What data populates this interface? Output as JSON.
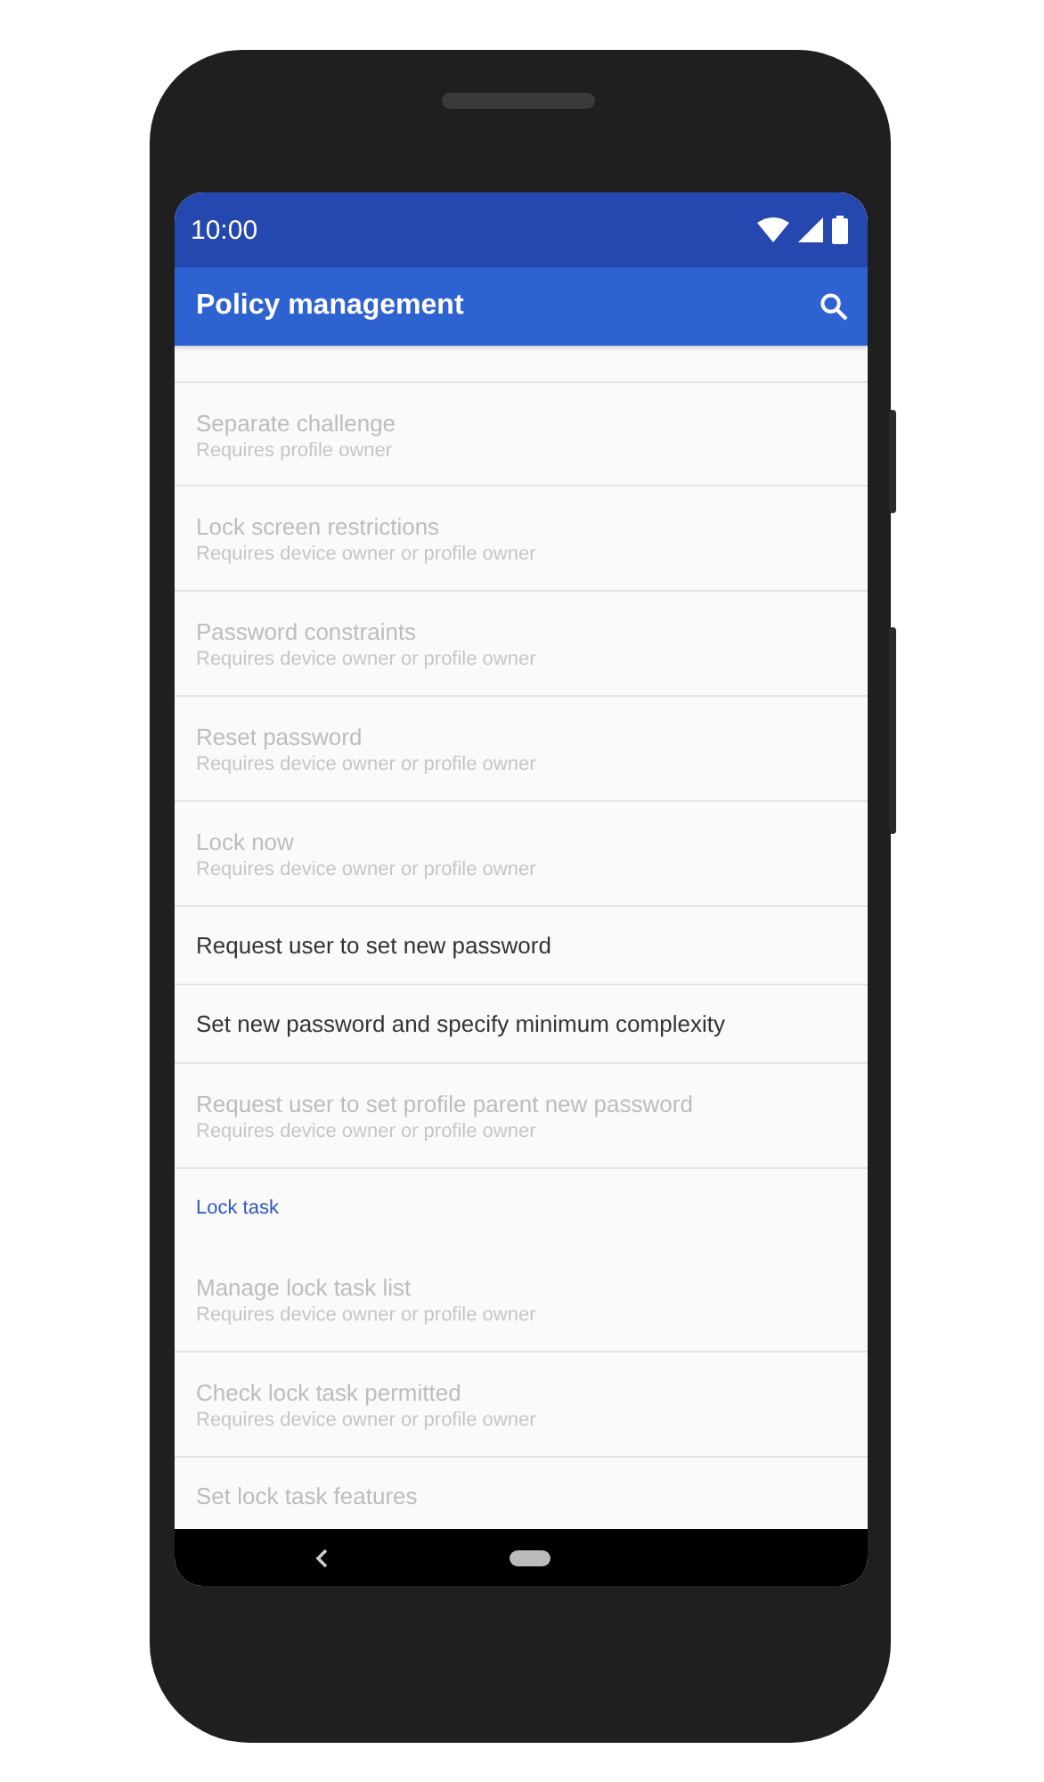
{
  "status_bar": {
    "time": "10:00"
  },
  "app_bar": {
    "title": "Policy management"
  },
  "list": [
    {
      "kind": "row",
      "title": "Separate challenge",
      "subtitle": "Requires profile owner",
      "disabled": true
    },
    {
      "kind": "row",
      "title": "Lock screen restrictions",
      "subtitle": "Requires device owner or profile owner",
      "disabled": true
    },
    {
      "kind": "row",
      "title": "Password constraints",
      "subtitle": "Requires device owner or profile owner",
      "disabled": true
    },
    {
      "kind": "row",
      "title": "Reset password",
      "subtitle": "Requires device owner or profile owner",
      "disabled": true
    },
    {
      "kind": "row",
      "title": "Lock now",
      "subtitle": "Requires device owner or profile owner",
      "disabled": true
    },
    {
      "kind": "row",
      "title": "Request user to set new password",
      "disabled": false
    },
    {
      "kind": "row",
      "title": "Set new password and specify minimum complexity",
      "disabled": false
    },
    {
      "kind": "row",
      "title": "Request user to set profile parent new password",
      "subtitle": "Requires device owner or profile owner",
      "disabled": true
    },
    {
      "kind": "header",
      "title": "Lock task"
    },
    {
      "kind": "row",
      "title": "Manage lock task list",
      "subtitle": "Requires device owner or profile owner",
      "disabled": true
    },
    {
      "kind": "row",
      "title": "Check lock task permitted",
      "subtitle": "Requires device owner or profile owner",
      "disabled": true
    },
    {
      "kind": "row",
      "title": "Set lock task features",
      "disabled": true
    }
  ]
}
